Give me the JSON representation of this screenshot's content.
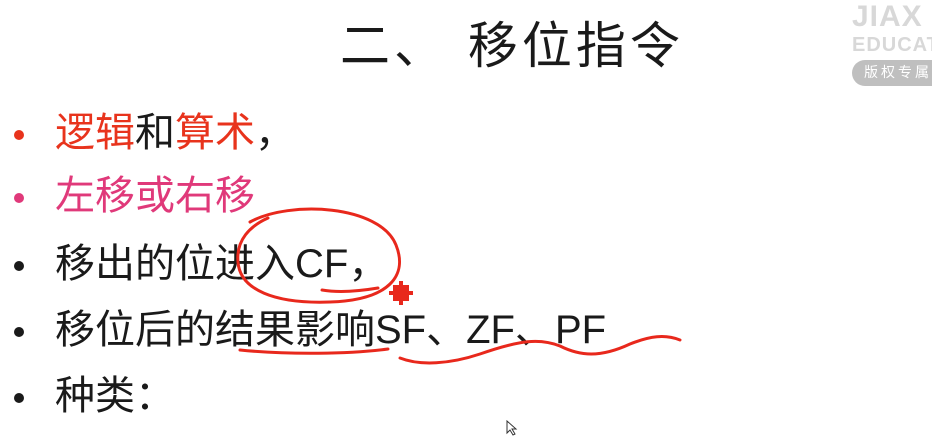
{
  "slide": {
    "title": "二、 移位指令",
    "bullets": [
      {
        "parts": [
          {
            "text": "逻辑",
            "color": "#e8331c"
          },
          {
            "text": "和",
            "color": "#1a1a1a"
          },
          {
            "text": "算术",
            "color": "#e8331c"
          },
          {
            "text": "，",
            "color": "#1a1a1a"
          }
        ],
        "bullet_color": "#e8331c"
      },
      {
        "parts": [
          {
            "text": "左移或右移",
            "color": "#e0397a"
          }
        ],
        "bullet_color": "#e0397a"
      },
      {
        "parts": [
          {
            "text": "移出的位进入",
            "color": "#1a1a1a"
          },
          {
            "text": "CF",
            "color": "#1a1a1a"
          },
          {
            "text": "，",
            "color": "#1a1a1a"
          }
        ],
        "bullet_color": "#1a1a1a"
      },
      {
        "parts": [
          {
            "text": "移位后的结果影响",
            "color": "#1a1a1a"
          },
          {
            "text": "SF、ZF、PF",
            "color": "#1a1a1a"
          }
        ],
        "bullet_color": "#1a1a1a"
      },
      {
        "parts": [
          {
            "text": "种类：",
            "color": "#1a1a1a"
          }
        ],
        "bullet_color": "#1a1a1a"
      }
    ]
  },
  "watermark": {
    "line1": "JIAX",
    "line2": "EDUCAT",
    "badge": "版权专属"
  },
  "annotations": {
    "ink_color": "#e8281c",
    "marker_color": "#e8281c"
  }
}
